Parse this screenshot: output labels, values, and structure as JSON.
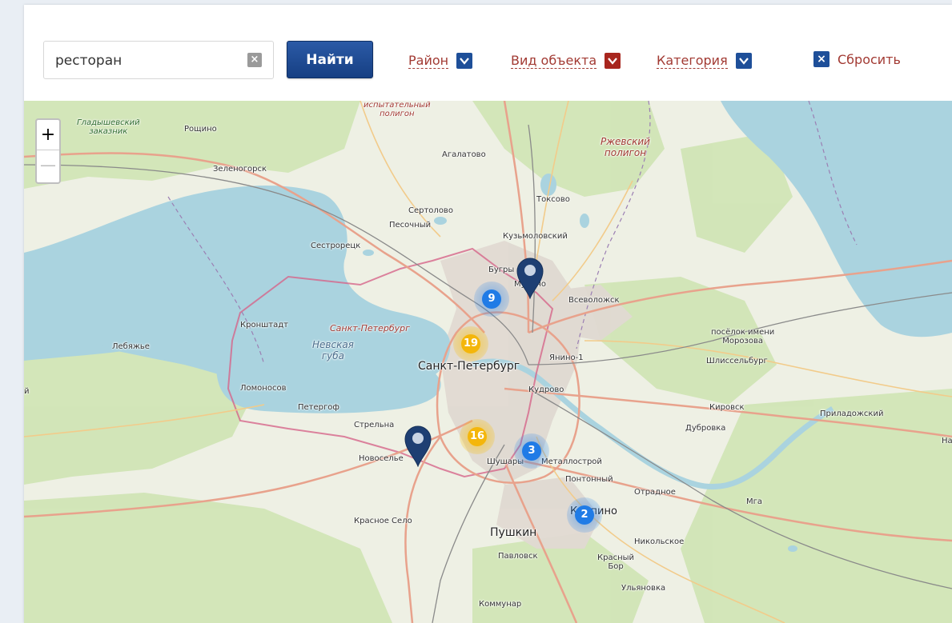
{
  "search": {
    "value": "ресторан",
    "clear_label": "×",
    "button_label": "Найти"
  },
  "filters": {
    "district_label": "Район",
    "object_type_label": "Вид объекта",
    "category_label": "Категория",
    "reset_label": "Сбросить",
    "reset_icon": "×"
  },
  "map": {
    "zoom_in_label": "+",
    "zoom_out_label": "—",
    "places": {
      "gladyshevsky": "Гладышевский\nзаказник",
      "roshchino": "Рощино",
      "zelenogorsk": "Зеленогорск",
      "ispytatelny": "испытательный\nполигон",
      "agalatovo": "Агалатово",
      "rzhevsky": "Ржевский\nполигон",
      "toksovo": "Токсово",
      "sertolovo": "Сертолово",
      "pesochny": "Песочный",
      "kuzmolovsky": "Кузьмоловский",
      "sestroretsk": "Сестрорецк",
      "bugry": "Бугры",
      "murino": "Мурино",
      "vsevolozhsk": "Всеволожск",
      "kronshtadt": "Кронштадт",
      "spb_italic": "Санкт-Петербург",
      "nevskaya": "Невская\nгуба",
      "lebyazhye": "Лебяжье",
      "spb": "Санкт-Петербург",
      "yanino": "Янино-1",
      "morozova": "посёлок имени\nМорозова",
      "shlisselburg": "Шлиссельбург",
      "lomonosov": "Ломоносов",
      "kudrovo": "Кудрово",
      "peterhof": "Петергоф",
      "kirovsk": "Кировск",
      "prila": "Приладожский",
      "strelna": "Стрельна",
      "dubrovka": "Дубровка",
      "novoselye": "Новоселье",
      "shushary": "Шушары",
      "metallostroy": "Металлострой",
      "pontonny": "Понтонный",
      "otradnoe": "Отрадное",
      "mga": "Мга",
      "kolpino": "Колпино",
      "krasnoe_selo": "Красное Село",
      "pushkin": "Пушкин",
      "nikolskoe": "Никольское",
      "pavlovsk": "Павловск",
      "krasny_bor": "Красный\nБор",
      "ulyanovka": "Ульяновка",
      "kommunar": "Коммунар",
      "edge_left": "й",
      "edge_right": "На"
    },
    "clusters": [
      {
        "count": "9",
        "color": "blue"
      },
      {
        "count": "19",
        "color": "yellow"
      },
      {
        "count": "16",
        "color": "yellow"
      },
      {
        "count": "3",
        "color": "blue"
      },
      {
        "count": "2",
        "color": "blue"
      }
    ],
    "colors": {
      "water": "#aad3df",
      "land": "#eef0e4",
      "forest": "#cfe4b4",
      "city": "#e0d9d2",
      "cluster_blue": "#1f7be6",
      "cluster_yellow": "#f4b60b",
      "pin": "#1e3f73"
    }
  }
}
